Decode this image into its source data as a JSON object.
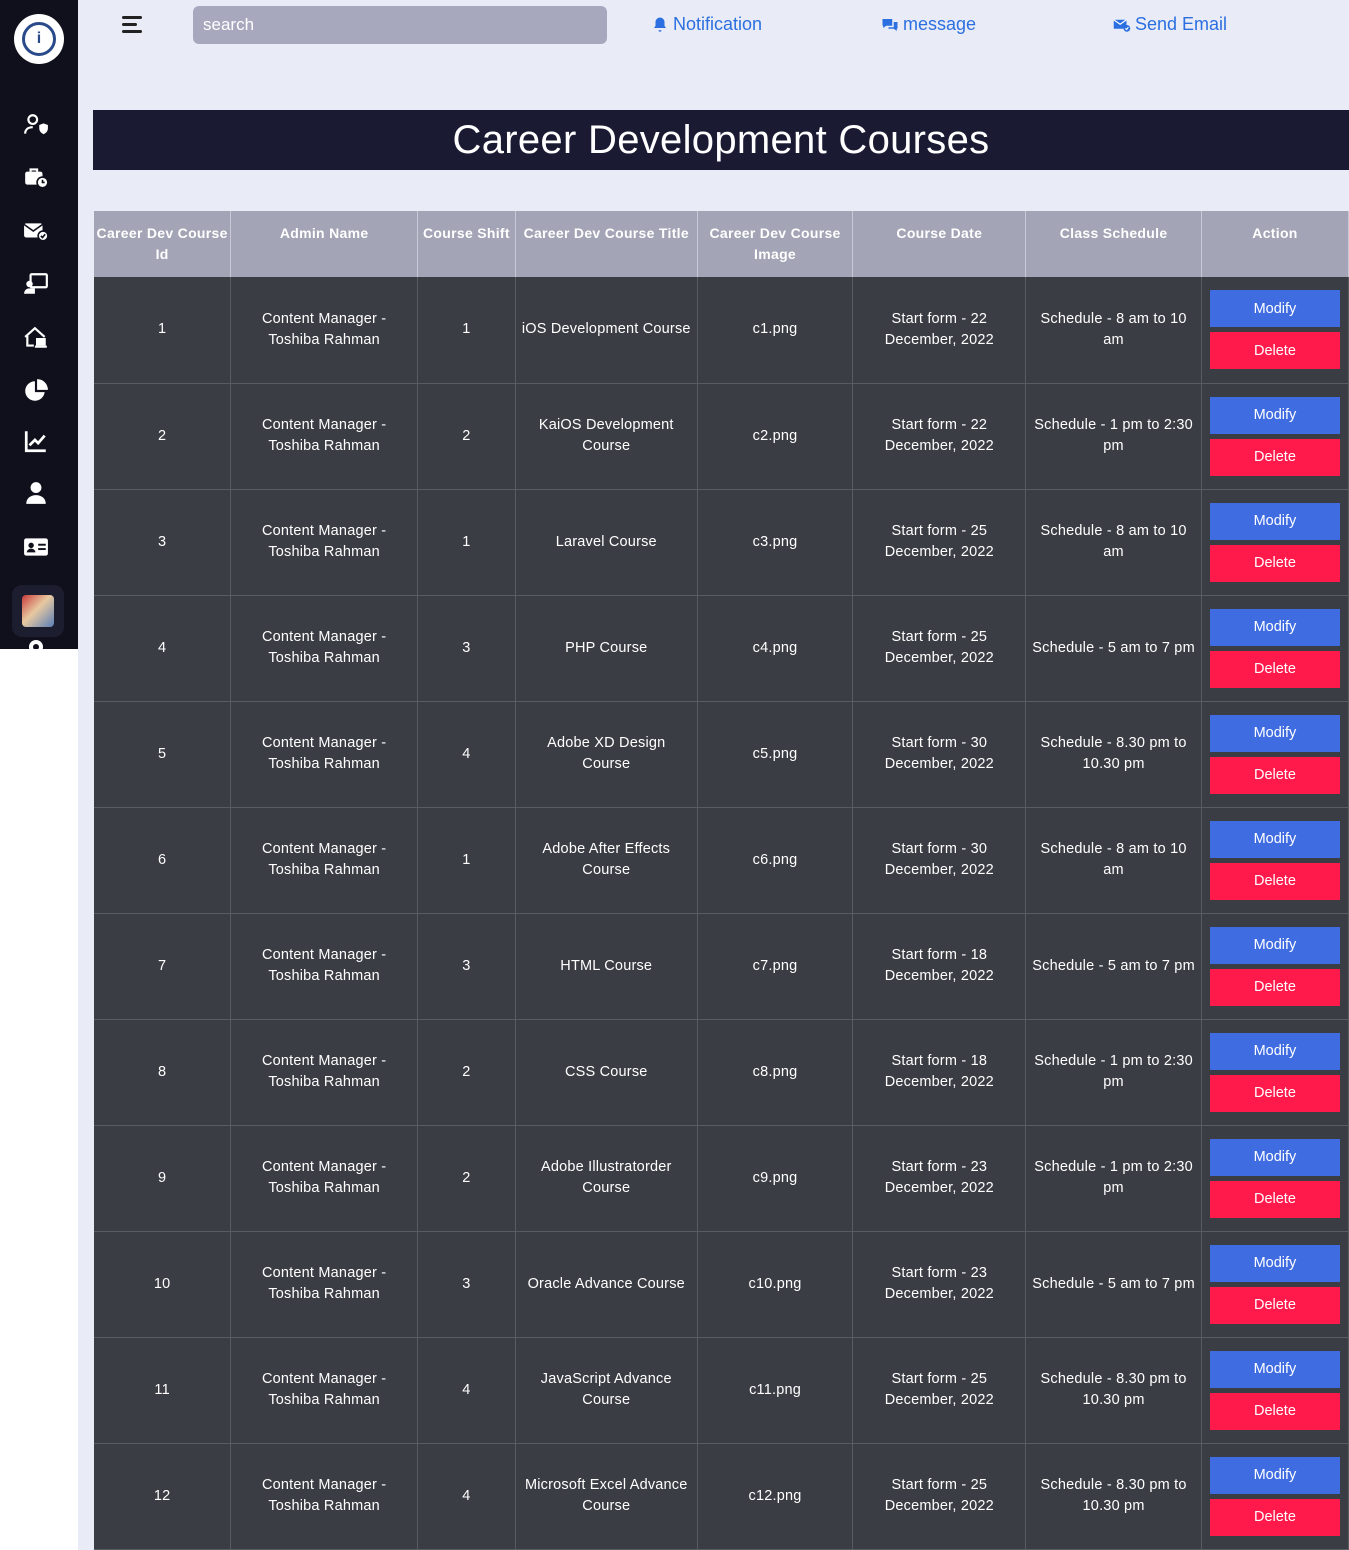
{
  "header": {
    "search_placeholder": "search",
    "notification_label": "Notification",
    "message_label": "message",
    "send_email_label": "Send Email"
  },
  "page": {
    "title": "Career Development Courses"
  },
  "table": {
    "headers": [
      "Career Dev Course Id",
      "Admin Name",
      "Course Shift",
      "Career Dev Course Title",
      "Career Dev Course Image",
      "Course Date",
      "Class Schedule",
      "Action"
    ],
    "modify_label": "Modify",
    "delete_label": "Delete",
    "rows": [
      {
        "id": "1",
        "admin": "Content Manager - Toshiba Rahman",
        "shift": "1",
        "title": "iOS Development Course",
        "image": "c1.png",
        "date": "Start form - 22 December, 2022",
        "schedule": "Schedule - 8 am to 10 am"
      },
      {
        "id": "2",
        "admin": "Content Manager - Toshiba Rahman",
        "shift": "2",
        "title": "KaiOS Development Course",
        "image": "c2.png",
        "date": "Start form - 22 December, 2022",
        "schedule": "Schedule - 1 pm to 2:30 pm"
      },
      {
        "id": "3",
        "admin": "Content Manager - Toshiba Rahman",
        "shift": "1",
        "title": "Laravel Course",
        "image": "c3.png",
        "date": "Start form - 25 December, 2022",
        "schedule": "Schedule - 8 am to 10 am"
      },
      {
        "id": "4",
        "admin": "Content Manager - Toshiba Rahman",
        "shift": "3",
        "title": "PHP Course",
        "image": "c4.png",
        "date": "Start form - 25 December, 2022",
        "schedule": "Schedule - 5 am to 7 pm"
      },
      {
        "id": "5",
        "admin": "Content Manager - Toshiba Rahman",
        "shift": "4",
        "title": "Adobe XD Design Course",
        "image": "c5.png",
        "date": "Start form - 30 December, 2022",
        "schedule": "Schedule - 8.30 pm to 10.30 pm"
      },
      {
        "id": "6",
        "admin": "Content Manager - Toshiba Rahman",
        "shift": "1",
        "title": "Adobe After Effects Course",
        "image": "c6.png",
        "date": "Start form - 30 December, 2022",
        "schedule": "Schedule - 8 am to 10 am"
      },
      {
        "id": "7",
        "admin": "Content Manager - Toshiba Rahman",
        "shift": "3",
        "title": "HTML Course",
        "image": "c7.png",
        "date": "Start form - 18 December, 2022",
        "schedule": "Schedule - 5 am to 7 pm"
      },
      {
        "id": "8",
        "admin": "Content Manager - Toshiba Rahman",
        "shift": "2",
        "title": "CSS Course",
        "image": "c8.png",
        "date": "Start form - 18 December, 2022",
        "schedule": "Schedule - 1 pm to 2:30 pm"
      },
      {
        "id": "9",
        "admin": "Content Manager - Toshiba Rahman",
        "shift": "2",
        "title": "Adobe Illustratorder Course",
        "image": "c9.png",
        "date": "Start form - 23 December, 2022",
        "schedule": "Schedule - 1 pm to 2:30 pm"
      },
      {
        "id": "10",
        "admin": "Content Manager - Toshiba Rahman",
        "shift": "3",
        "title": "Oracle Advance Course",
        "image": "c10.png",
        "date": "Start form - 23 December, 2022",
        "schedule": "Schedule - 5 am to 7 pm"
      },
      {
        "id": "11",
        "admin": "Content Manager - Toshiba Rahman",
        "shift": "4",
        "title": "JavaScript Advance Course",
        "image": "c11.png",
        "date": "Start form - 25 December, 2022",
        "schedule": "Schedule - 8.30 pm to 10.30 pm"
      },
      {
        "id": "12",
        "admin": "Content Manager - Toshiba Rahman",
        "shift": "4",
        "title": "Microsoft Excel Advance Course",
        "image": "c12.png",
        "date": "Start form - 25 December, 2022",
        "schedule": "Schedule - 8.30 pm to 10.30 pm"
      }
    ]
  },
  "sidebar": {
    "icons": [
      "user-shield-icon",
      "briefcase-clock-icon",
      "mail-check-icon",
      "chalkboard-teacher-icon",
      "house-laptop-icon",
      "pie-chart-icon",
      "line-chart-icon",
      "user-icon",
      "id-card-icon"
    ],
    "avatar": "profile-avatar",
    "settings": "gear-icon"
  },
  "colors": {
    "sidebar_bg": "#10101c",
    "title_bar_bg": "#1b1a33",
    "content_bg": "#e9ecf7",
    "header_cell_bg": "#a3a4b5",
    "row_bg": "#3b3d44",
    "modify_button": "#3f6ce0",
    "delete_button": "#ff1a4b",
    "link_color": "#2b6fe0"
  }
}
